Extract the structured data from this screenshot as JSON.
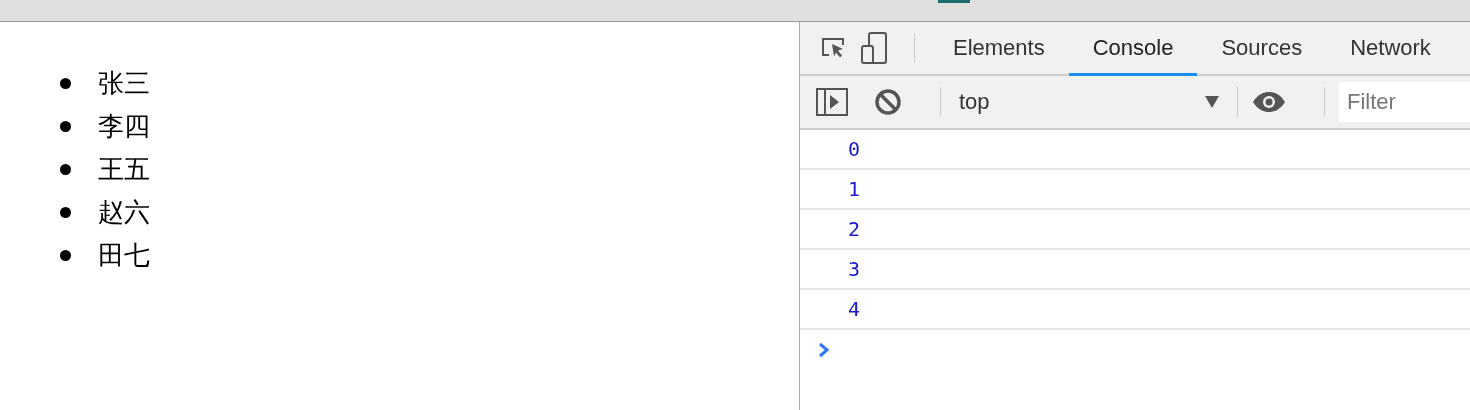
{
  "page": {
    "list_items": [
      "张三",
      "李四",
      "王五",
      "赵六",
      "田七"
    ]
  },
  "devtools": {
    "tabs": [
      {
        "label": "Elements",
        "selected": false
      },
      {
        "label": "Console",
        "selected": true
      },
      {
        "label": "Sources",
        "selected": false
      },
      {
        "label": "Network",
        "selected": false
      }
    ],
    "context": "top",
    "filter": {
      "placeholder": "Filter"
    },
    "console_lines": [
      "0",
      "1",
      "2",
      "3",
      "4"
    ]
  }
}
